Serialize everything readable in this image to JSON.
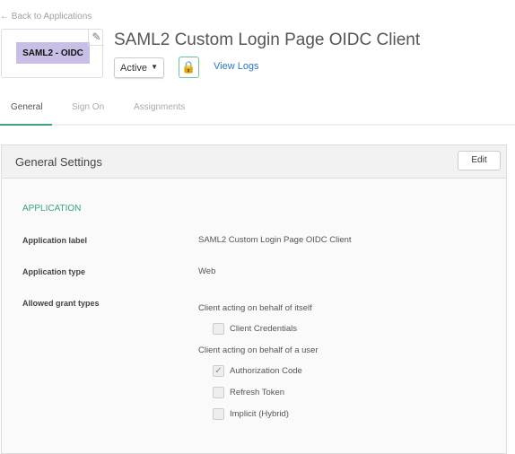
{
  "nav": {
    "back_link": "← Back to Applications"
  },
  "app": {
    "logo_text": "SAML2 - OIDC",
    "title": "SAML2 Custom Login Page OIDC Client",
    "status": "Active",
    "view_logs": "View Logs"
  },
  "tabs": [
    {
      "label": "General",
      "active": true
    },
    {
      "label": "Sign On"
    },
    {
      "label": "Assignments"
    }
  ],
  "panel": {
    "title": "General Settings",
    "edit": "Edit",
    "section": "APPLICATION",
    "rows": [
      {
        "label": "Application label",
        "value": "SAML2 Custom Login Page OIDC Client"
      },
      {
        "label": "Application type",
        "value": "Web"
      },
      {
        "label": "Allowed grant types"
      }
    ],
    "grant_groups": [
      {
        "heading": "Client acting on behalf of itself"
      },
      {
        "heading": "Client acting on behalf of a user"
      }
    ],
    "grants": [
      {
        "label": "Client Credentials",
        "checked": false
      },
      {
        "label": "Authorization Code",
        "checked": true
      },
      {
        "label": "Refresh Token",
        "checked": false
      },
      {
        "label": "Implicit (Hybrid)",
        "checked": false
      }
    ]
  }
}
